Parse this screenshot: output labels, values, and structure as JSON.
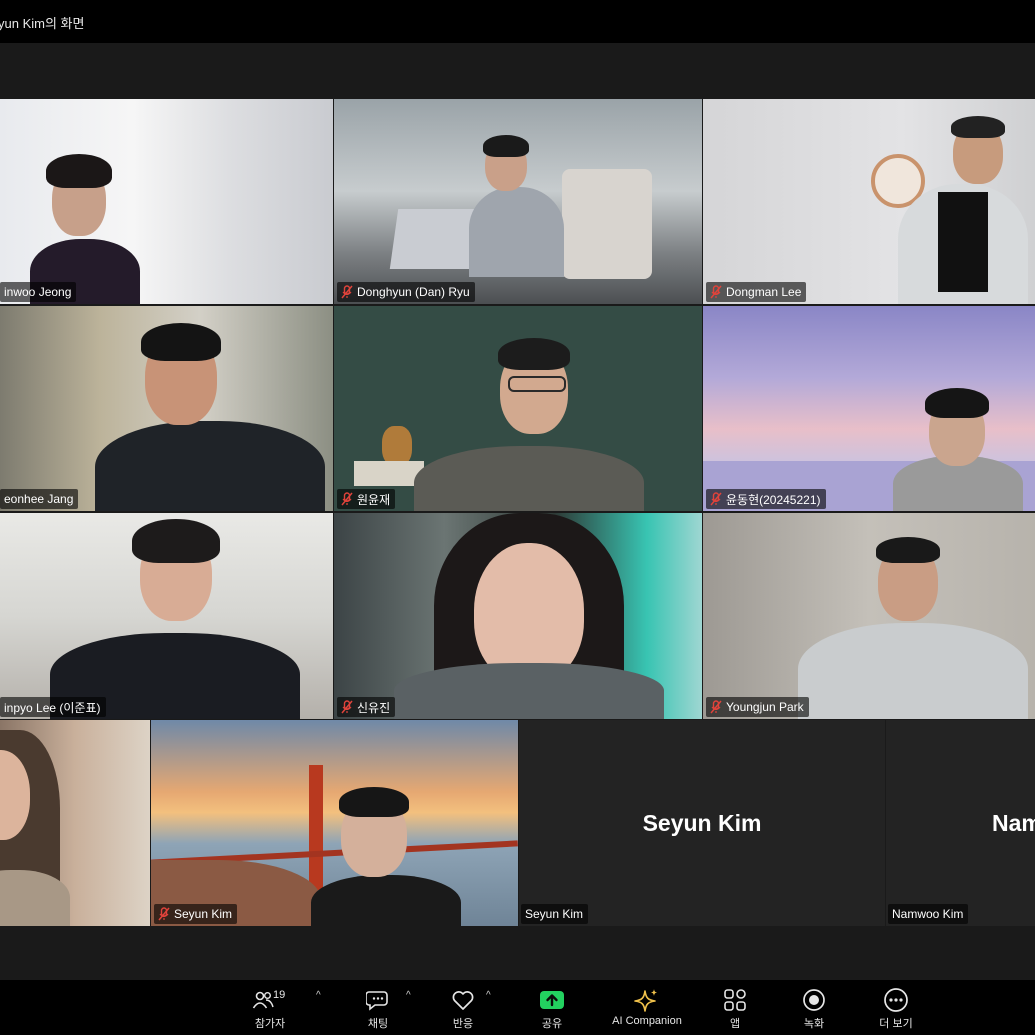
{
  "window": {
    "title": "yun Kim의 화면"
  },
  "tiles": [
    {
      "name": "inwoo Jeong",
      "muted": false,
      "style": "video"
    },
    {
      "name": "Donghyun (Dan) Ryu",
      "muted": true,
      "style": "video"
    },
    {
      "name": "Dongman Lee",
      "muted": true,
      "style": "video"
    },
    {
      "name": "eonhee Jang",
      "muted": false,
      "style": "video"
    },
    {
      "name": "원윤재",
      "muted": true,
      "style": "video"
    },
    {
      "name": "윤동현(20245221)",
      "muted": true,
      "style": "video"
    },
    {
      "name": "inpyo Lee (이준표)",
      "muted": false,
      "style": "video"
    },
    {
      "name": "신유진",
      "muted": true,
      "style": "video"
    },
    {
      "name": "Youngjun Park",
      "muted": true,
      "style": "video"
    },
    {
      "name": "",
      "muted": false,
      "style": "video"
    },
    {
      "name": "Seyun Kim",
      "muted": true,
      "style": "video"
    },
    {
      "name": "Seyun Kim",
      "muted": false,
      "style": "no-video",
      "display_name": "Seyun Kim"
    },
    {
      "name": "Namwoo Kim",
      "muted": false,
      "style": "no-video",
      "display_name": "Nam"
    }
  ],
  "toolbar": {
    "participants": {
      "label": "참가자",
      "count": "19",
      "icon": "participants-icon"
    },
    "chat": {
      "label": "채팅",
      "icon": "chat-icon"
    },
    "reactions": {
      "label": "반응",
      "icon": "heart-icon"
    },
    "share": {
      "label": "공유",
      "icon": "share-icon",
      "color": "#23d160"
    },
    "ai": {
      "label": "AI Companion",
      "icon": "sparkle-icon",
      "color": "#f0c14b"
    },
    "apps": {
      "label": "앱",
      "icon": "apps-icon"
    },
    "record": {
      "label": "녹화",
      "icon": "record-icon"
    },
    "more": {
      "label": "더 보기",
      "icon": "more-icon"
    }
  },
  "colors": {
    "accent_green": "#23d160",
    "muted_red": "#e0433b"
  }
}
